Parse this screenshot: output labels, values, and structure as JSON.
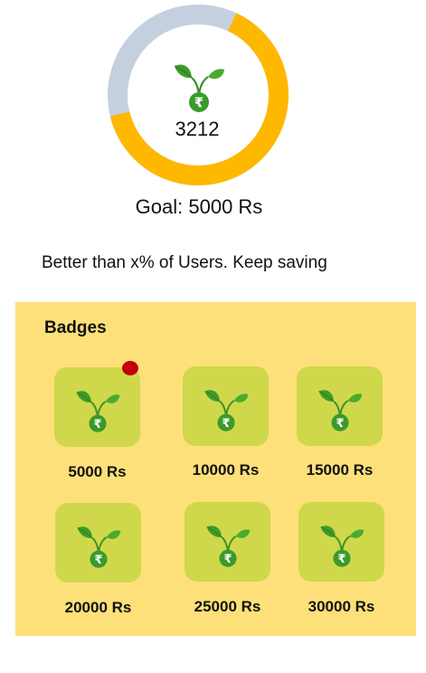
{
  "savings": {
    "current": "3212",
    "progress_fraction": 0.6424,
    "goal_text": "Goal: 5000 Rs",
    "rank_text": "Better than x% of Users. Keep saving",
    "ring_color": "#ffb800",
    "ring_remaining_color": "#c5d0de",
    "icon": "seedling-rupee-icon"
  },
  "badges": {
    "title": "Badges",
    "tile_color": "#cfd84a",
    "panel_color": "#fde07a",
    "items": [
      {
        "label": "5000 Rs",
        "icon": "seedling-rupee-icon",
        "new": true
      },
      {
        "label": "10000 Rs",
        "icon": "seedling-rupee-icon"
      },
      {
        "label": "15000 Rs",
        "icon": "seedling-rupee-icon"
      },
      {
        "label": "20000 Rs",
        "icon": "seedling-rupee-icon"
      },
      {
        "label": "25000 Rs",
        "icon": "seedling-rupee-icon"
      },
      {
        "label": "30000 Rs",
        "icon": "seedling-rupee-icon"
      }
    ]
  }
}
